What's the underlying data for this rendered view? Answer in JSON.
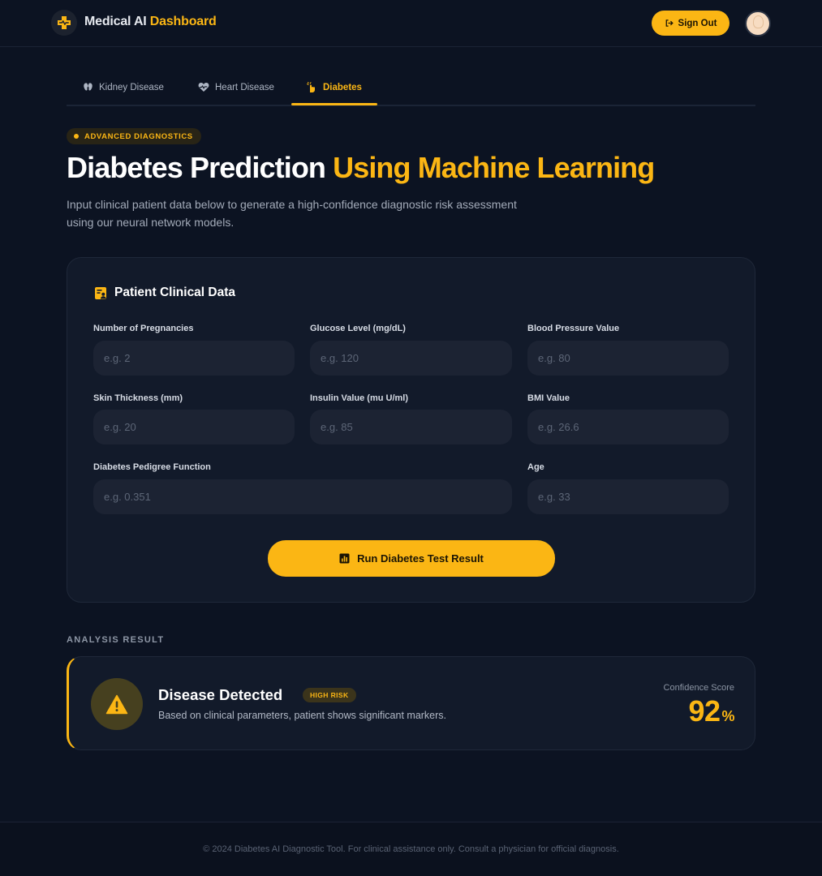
{
  "header": {
    "brand_main": "Medical AI",
    "brand_accent": "Dashboard",
    "signout_label": "Sign Out",
    "icons": {
      "logo": "medical-cross-icon",
      "signout": "logout-icon",
      "avatar": "user-avatar"
    }
  },
  "tabs": [
    {
      "label": "Kidney Disease",
      "icon": "kidney-icon",
      "active": false
    },
    {
      "label": "Heart Disease",
      "icon": "heart-pulse-icon",
      "active": false
    },
    {
      "label": "Diabetes",
      "icon": "hand-pointer-icon",
      "active": true
    }
  ],
  "hero": {
    "badge": "ADVANCED DIAGNOSTICS",
    "title_main": "Diabetes Prediction",
    "title_accent": "Using Machine Learning",
    "subtitle": "Input clinical patient data below to generate a high-confidence diagnostic risk assessment using our neural network models."
  },
  "form": {
    "title": "Patient Clinical Data",
    "fields": [
      {
        "label": "Number of Pregnancies",
        "placeholder": "e.g. 2",
        "value": ""
      },
      {
        "label": "Glucose Level (mg/dL)",
        "placeholder": "e.g. 120",
        "value": ""
      },
      {
        "label": "Blood Pressure Value",
        "placeholder": "e.g. 80",
        "value": ""
      },
      {
        "label": "Skin Thickness (mm)",
        "placeholder": "e.g. 20",
        "value": ""
      },
      {
        "label": "Insulin Value (mu U/ml)",
        "placeholder": "e.g. 85",
        "value": ""
      },
      {
        "label": "BMI Value",
        "placeholder": "e.g. 26.6",
        "value": ""
      },
      {
        "label": "Diabetes Pedigree Function",
        "placeholder": "e.g. 0.351",
        "value": ""
      },
      {
        "label": "Age",
        "placeholder": "e.g. 33",
        "value": ""
      }
    ],
    "submit_label": "Run Diabetes Test Result"
  },
  "result": {
    "section_label": "ANALYSIS RESULT",
    "title": "Disease Detected",
    "badge": "HIGH RISK",
    "description": "Based on clinical parameters, patient shows significant markers.",
    "confidence_label": "Confidence Score",
    "confidence_value": "92",
    "confidence_unit": "%"
  },
  "footer": {
    "text": "© 2024 Diabetes AI Diagnostic Tool. For clinical assistance only. Consult a physician for official diagnosis."
  },
  "colors": {
    "background": "#0c1322",
    "accent": "#fbb614",
    "card": "#121a2a",
    "input": "#1c2333"
  }
}
